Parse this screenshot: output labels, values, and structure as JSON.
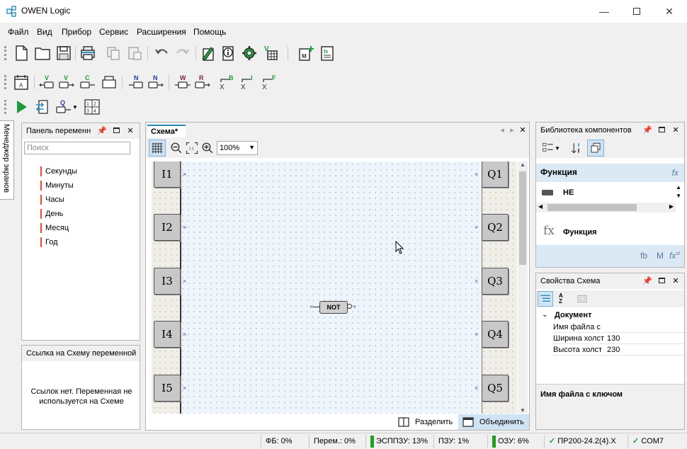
{
  "app": {
    "title": "OWEN Logic"
  },
  "menu": [
    "Файл",
    "Вид",
    "Прибор",
    "Сервис",
    "Расширения",
    "Помощь"
  ],
  "toolbar_icons": {
    "row1": [
      "new-file-icon",
      "open-folder-icon",
      "save-icon",
      "print-icon",
      "copy-icon",
      "paste-icon",
      "undo-icon",
      "redo-icon",
      "device-write-icon",
      "device-info-icon",
      "settings-gear-icon",
      "variables-table-icon",
      "add-macro-icon",
      "function-icon"
    ],
    "row2_letters": {
      "V1": "V",
      "V2": "V",
      "C": "C",
      "N1": "N",
      "N2": "N",
      "W": "W",
      "R": "R",
      "B": "B",
      "I": "I",
      "F": "F",
      "XB": "X",
      "XI": "X",
      "XF": "X",
      "calendar": "A"
    },
    "row3_letters": {
      "Q": "Q"
    }
  },
  "side_tab": "Менеджер экранов",
  "var_panel": {
    "title": "Панель переменн",
    "search_placeholder": "Поиск",
    "items": [
      "Секунды",
      "Минуты",
      "Часы",
      "День",
      "Месяц",
      "Год"
    ]
  },
  "ref_panel": {
    "title": "Ссылка на Схему переменной",
    "message_line1": "Ссылок нет. Переменная не",
    "message_line2": "используется на Схеме"
  },
  "schema": {
    "tab": "Схема*",
    "zoom": "100%",
    "inputs": [
      "I1",
      "I2",
      "I3",
      "I4",
      "I5"
    ],
    "outputs": [
      "Q1",
      "Q2",
      "Q3",
      "Q4",
      "Q5"
    ],
    "block": "NOT",
    "split_label": "Разделить",
    "merge_label": "Объединить"
  },
  "library": {
    "title": "Библиотека компонентов",
    "section": "Функция",
    "section_fx": "fx",
    "item": "НЕ",
    "function_label": "Функция",
    "fx_glyph": "fx",
    "footer_fb": "fb",
    "footer_m": "M",
    "footer_fx": "fx",
    "footer_fx_sup": "st"
  },
  "properties": {
    "title": "Свойства Схема",
    "az_label": "AZ",
    "group": "Документ",
    "rows": [
      {
        "label": "Имя файла с",
        "value": ""
      },
      {
        "label": "Ширина холст",
        "value": "130"
      },
      {
        "label": "Высота холст",
        "value": "230"
      }
    ],
    "desc_title": "Имя файла с ключом"
  },
  "status": {
    "fb": "ФБ: 0%",
    "perem": "Перем.: 0%",
    "eeprom": "ЭСППЗУ: 13%",
    "pzu": "ПЗУ: 1%",
    "ozu": "ОЗУ: 6%",
    "device": "ПР200-24.2(4).X",
    "port": "COM7"
  },
  "colors": {
    "accent": "#2a8ab8",
    "var_marker": "#e8452c",
    "canvas_bg": "#eef5fb",
    "ok_green": "#1ea01e"
  }
}
